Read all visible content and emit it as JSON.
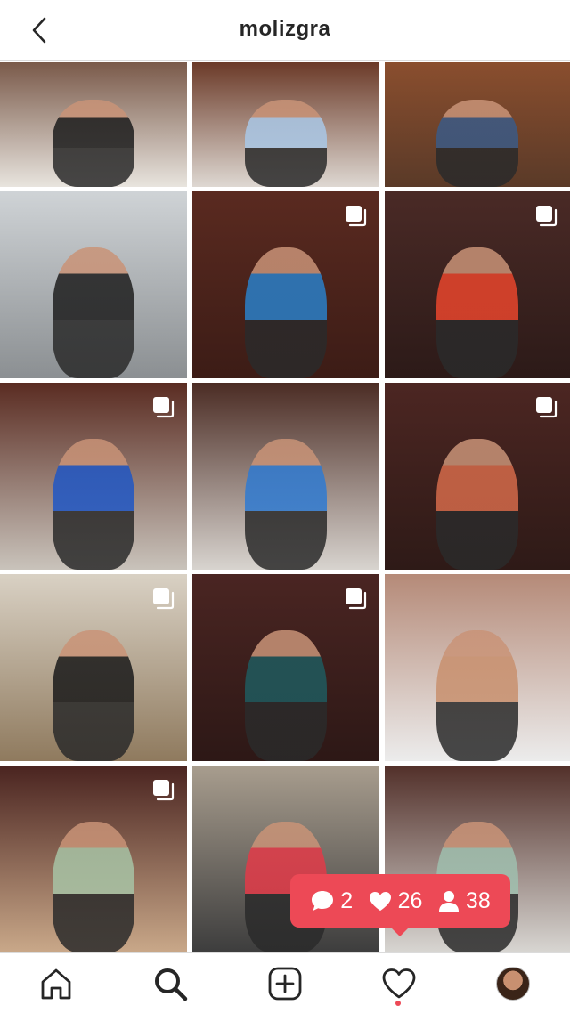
{
  "header": {
    "title": "molizgra",
    "back_icon": "chevron-left-icon"
  },
  "grid": {
    "tiles": [
      {
        "name": "post-1",
        "bg": [
          "#7a5a4a",
          "#e8e4de"
        ],
        "figure": "#1c1c1c",
        "multi": false
      },
      {
        "name": "post-2",
        "bg": [
          "#6b3a28",
          "#ded8d2"
        ],
        "figure": "#a9c7e6",
        "multi": false
      },
      {
        "name": "post-3",
        "bg": [
          "#8a4e2e",
          "#5a3a28"
        ],
        "figure": "#3b5a85",
        "multi": false
      },
      {
        "name": "post-4",
        "bg": [
          "#cfd3d6",
          "#8b8f92"
        ],
        "figure": "#1e1e1e",
        "multi": false
      },
      {
        "name": "post-5",
        "bg": [
          "#5a2a20",
          "#3c1c16"
        ],
        "figure": "#2a7fc8",
        "multi": true
      },
      {
        "name": "post-6",
        "bg": [
          "#4a2a26",
          "#2c1a18"
        ],
        "figure": "#e8452c",
        "multi": true
      },
      {
        "name": "post-7",
        "bg": [
          "#5a2c22",
          "#c9c3bb"
        ],
        "figure": "#1f56c4",
        "multi": true
      },
      {
        "name": "post-8",
        "bg": [
          "#4b2c24",
          "#d8d4cf"
        ],
        "figure": "#2f7ad1",
        "multi": false
      },
      {
        "name": "post-9",
        "bg": [
          "#4c2622",
          "#2e1a17"
        ],
        "figure": "#d46a4a",
        "multi": true
      },
      {
        "name": "post-10",
        "bg": [
          "#d9d1c4",
          "#8f7a5e"
        ],
        "figure": "#1a1a1a",
        "multi": true
      },
      {
        "name": "post-11",
        "bg": [
          "#4a2522",
          "#2d1816"
        ],
        "figure": "#1f5a5e",
        "multi": true
      },
      {
        "name": "post-12",
        "bg": [
          "#b58a78",
          "#ececec"
        ],
        "figure": "#c8906e",
        "multi": false
      },
      {
        "name": "post-13",
        "bg": [
          "#4a2420",
          "#c9a889"
        ],
        "figure": "#a7c3a5",
        "multi": true
      },
      {
        "name": "post-14",
        "bg": [
          "#a89d8e",
          "#3d3d3d"
        ],
        "figure": "#e23a48",
        "multi": false
      },
      {
        "name": "post-15",
        "bg": [
          "#52302a",
          "#d8d6d2"
        ],
        "figure": "#9fbfae",
        "multi": false
      }
    ]
  },
  "notification": {
    "comments": "2",
    "likes": "26",
    "followers": "38",
    "color": "#ed4956"
  },
  "bottom_nav": {
    "items": [
      "home-icon",
      "search-icon",
      "add-post-icon",
      "activity-heart-icon",
      "profile-avatar"
    ],
    "active_dot_color": "#ed4956"
  }
}
